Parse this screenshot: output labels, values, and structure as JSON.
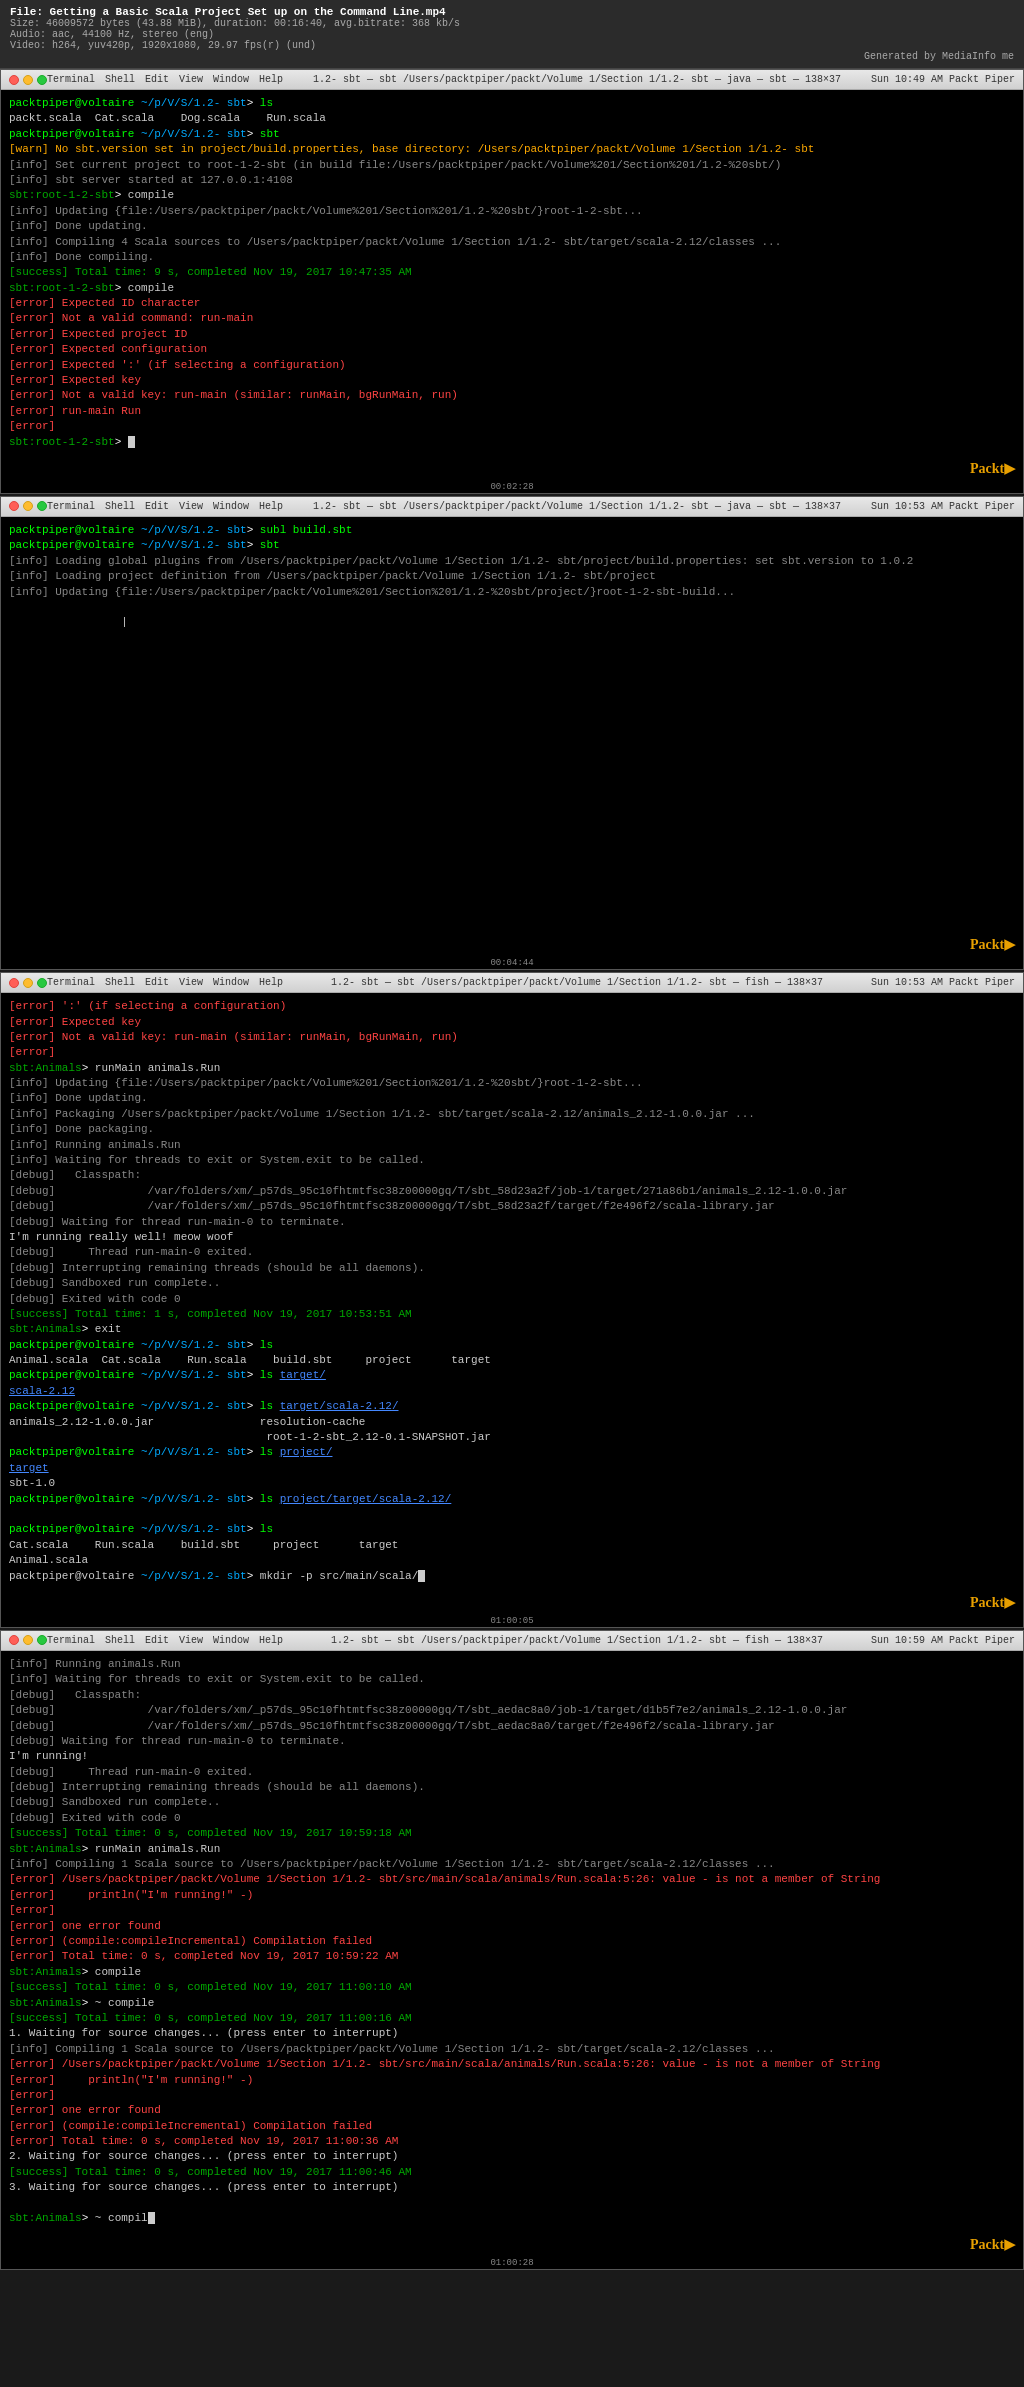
{
  "video": {
    "title": "File: Getting a Basic Scala Project Set up on the Command Line.mp4",
    "size": "Size: 46009572 bytes (43.88 MiB), duration: 00:16:40, avg.bitrate: 368 kb/s",
    "audio": "Audio: aac, 44100 Hz, stereo (eng)",
    "video_stream": "Video: h264, yuv420p, 1920x1080, 29.97 fps(r) (und)",
    "generated": "Generated by MediaInfo me"
  },
  "terminal1": {
    "title": "1.2- sbt — sbt /Users/packtpiper/packt/Volume 1/Section 1/1.2- sbt — java — sbt — 138×37",
    "menu": [
      "Terminal",
      "Shell",
      "Edit",
      "View",
      "Window",
      "Help"
    ],
    "time": "Sun 10:49 AM  Packt Piper",
    "lines": [
      {
        "type": "prompt",
        "text": "packtpiper@voltaire ~/p/V/S/1.2- sbt> ls"
      },
      {
        "type": "output",
        "text": "packt.scala  Cat.scala    Dog.scala    Run.scala"
      },
      {
        "type": "prompt",
        "text": "packtpiper@voltaire ~/p/V/S/1.2- sbt> sbt"
      },
      {
        "type": "warn",
        "text": "[warn] No sbt.version set in project/build.properties, base directory: /Users/packtpiper/packt/Volume 1/Section 1/1.2- sbt"
      },
      {
        "type": "info",
        "text": "[info] Set current project to root-1-2-sbt (in build file:/Users/packtpiper/packt/Volume%201/Section%201/1.2-%20sbt/)"
      },
      {
        "type": "info",
        "text": "[info] sbt server started at 127.0.0.1:4108"
      },
      {
        "type": "prompt",
        "text": "sbt:root-1-2-sbt> compile"
      },
      {
        "type": "info",
        "text": "[info] Updating {file:/Users/packtpiper/packt/Volume%201/Section%201/1.2-%20sbt/}root-1-2-sbt..."
      },
      {
        "type": "info",
        "text": "[info] Done updating."
      },
      {
        "type": "info",
        "text": "[info] Compiling 4 Scala sources to /Users/packtpiper/packt/Volume 1/Section 1/1.2- sbt/target/scala-2.12/classes ..."
      },
      {
        "type": "info",
        "text": "[info] Done compiling."
      },
      {
        "type": "success",
        "text": "[success] Total time: 9 s, completed Nov 19, 2017 10:47:35 AM"
      },
      {
        "type": "prompt",
        "text": "sbt:root-1-2-sbt> compile"
      },
      {
        "type": "error",
        "text": "[error] Expected ID character"
      },
      {
        "type": "error",
        "text": "[error] Not a valid command: run-main"
      },
      {
        "type": "error",
        "text": "[error] Expected project ID"
      },
      {
        "type": "error",
        "text": "[error] Expected configuration"
      },
      {
        "type": "error",
        "text": "[error] Expected ':' (if selecting a configuration)"
      },
      {
        "type": "error",
        "text": "[error] Expected key"
      },
      {
        "type": "error",
        "text": "[error] Not a valid key: run-main (similar: runMain, bgRunMain, run)"
      },
      {
        "type": "error",
        "text": "[error] run-main Run"
      },
      {
        "type": "error",
        "text": "[error]"
      },
      {
        "type": "prompt-cursor",
        "text": "sbt:root-1-2-sbt> "
      }
    ],
    "packt": "Packt▶",
    "timestamp": "00:02:28"
  },
  "terminal2": {
    "title": "1.2- sbt — sbt /Users/packtpiper/packt/Volume 1/Section 1/1.2- sbt — java — sbt — 138×37",
    "menu": [
      "Terminal",
      "Shell",
      "Edit",
      "View",
      "Window",
      "Help"
    ],
    "time": "Sun 10:53 AM  Packt Piper",
    "lines": [
      {
        "type": "prompt",
        "text": "packtpiper@voltaire ~/p/V/S/1.2- sbt> subl build.sbt"
      },
      {
        "type": "prompt",
        "text": "packtpiper@voltaire ~/p/V/S/1.2- sbt> sbt"
      },
      {
        "type": "info",
        "text": "[info] Loading global plugins from /Users/packtpiper/packt/Volume 1/Section 1/1.2- sbt/project/build.properties: set sbt.version to 1.0.2"
      },
      {
        "type": "info",
        "text": "[info] Loading project definition from /Users/packtpiper/packt/Volume 1/Section 1/1.2- sbt/project"
      },
      {
        "type": "info",
        "text": "[info] Updating {file:/Users/packtpiper/packt/Volume%201/Section%201/1.2-%20sbt/project/}root-1-2-sbt-build..."
      },
      {
        "type": "blank",
        "text": ""
      },
      {
        "type": "output",
        "text": "                 |"
      },
      {
        "type": "blank",
        "text": ""
      },
      {
        "type": "blank",
        "text": ""
      },
      {
        "type": "blank",
        "text": ""
      },
      {
        "type": "blank",
        "text": ""
      },
      {
        "type": "blank",
        "text": ""
      },
      {
        "type": "blank",
        "text": ""
      },
      {
        "type": "blank",
        "text": ""
      },
      {
        "type": "blank",
        "text": ""
      },
      {
        "type": "blank",
        "text": ""
      },
      {
        "type": "blank",
        "text": ""
      },
      {
        "type": "blank",
        "text": ""
      },
      {
        "type": "blank",
        "text": ""
      },
      {
        "type": "blank",
        "text": ""
      },
      {
        "type": "blank",
        "text": ""
      },
      {
        "type": "blank",
        "text": ""
      },
      {
        "type": "blank",
        "text": ""
      },
      {
        "type": "blank",
        "text": ""
      },
      {
        "type": "blank",
        "text": ""
      },
      {
        "type": "blank",
        "text": ""
      },
      {
        "type": "blank",
        "text": ""
      },
      {
        "type": "blank",
        "text": ""
      },
      {
        "type": "blank",
        "text": ""
      },
      {
        "type": "blank",
        "text": ""
      },
      {
        "type": "blank",
        "text": ""
      }
    ],
    "packt": "Packt▶",
    "timestamp": "00:04:44"
  },
  "terminal3": {
    "title": "1.2- sbt — sbt /Users/packtpiper/packt/Volume 1/Section 1/1.2- sbt — fish — 138×37",
    "menu": [
      "Terminal",
      "Shell",
      "Edit",
      "View",
      "Window",
      "Help"
    ],
    "time": "Sun 10:53 AM  Packt Piper",
    "lines": [
      {
        "type": "error",
        "text": "[error] ':' (if selecting a configuration)"
      },
      {
        "type": "error",
        "text": "[error] Expected key"
      },
      {
        "type": "error",
        "text": "[error] Not a valid key: run-main (similar: runMain, bgRunMain, run)"
      },
      {
        "type": "error",
        "text": "[error]"
      },
      {
        "type": "prompt",
        "text": "sbt:Animals> runMain animals.Run"
      },
      {
        "type": "info",
        "text": "[info] Updating {file:/Users/packtpiper/packt/Volume%201/Section%201/1.2-%20sbt/}root-1-2-sbt..."
      },
      {
        "type": "info",
        "text": "[info] Done updating."
      },
      {
        "type": "info",
        "text": "[info] Packaging /Users/packtpiper/packt/Volume 1/Section 1/1.2- sbt/target/scala-2.12/animals_2.12-1.0.0.jar ..."
      },
      {
        "type": "info",
        "text": "[info] Done packaging."
      },
      {
        "type": "info",
        "text": "[info] Running animals.Run"
      },
      {
        "type": "info",
        "text": "[info] Waiting for threads to exit or System.exit to be called."
      },
      {
        "type": "debug",
        "text": "[debug]   Classpath:"
      },
      {
        "type": "debug",
        "text": "[debug]              /var/folders/xm/_p57ds_95c10fhtmtfsc38z00000gq/T/sbt_58d23a2f/job-1/target/271a86b1/animals_2.12-1.0.0.jar"
      },
      {
        "type": "debug",
        "text": "[debug]              /var/folders/xm/_p57ds_95c10fhtmtfsc38z00000gq/T/sbt_58d23a2f/target/f2e496f2/scala-library.jar"
      },
      {
        "type": "debug",
        "text": "[debug] Waiting for thread run-main-0 to terminate."
      },
      {
        "type": "output",
        "text": "I'm running really well! meow woof"
      },
      {
        "type": "debug",
        "text": "[debug]     Thread run-main-0 exited."
      },
      {
        "type": "debug",
        "text": "[debug] Interrupting remaining threads (should be all daemons)."
      },
      {
        "type": "debug",
        "text": "[debug] Sandboxed run complete.."
      },
      {
        "type": "debug",
        "text": "[debug] Exited with code 0"
      },
      {
        "type": "success",
        "text": "[success] Total time: 1 s, completed Nov 19, 2017 10:53:51 AM"
      },
      {
        "type": "prompt",
        "text": "sbt:Animals> exit"
      },
      {
        "type": "prompt",
        "text": "packtpiper@voltaire ~/p/V/S/1.2- sbt> ls"
      },
      {
        "type": "output",
        "text": "Animal.scala  Cat.scala    Run.scala    build.sbt     project      target"
      },
      {
        "type": "prompt",
        "text": "packtpiper@voltaire ~/p/V/S/1.2- sbt> ls target/"
      },
      {
        "type": "output-link",
        "text": "scala-2.12"
      },
      {
        "type": "prompt",
        "text": "packtpiper@voltaire ~/p/V/S/1.2- sbt> ls target/scala-2.12/"
      },
      {
        "type": "output",
        "text": "animals_2.12-1.0.0.jar                resolution-cache"
      },
      {
        "type": "output",
        "text": "                                       root-1-2-sbt_2.12-0.1-SNAPSHOT.jar"
      },
      {
        "type": "prompt",
        "text": "packtpiper@voltaire ~/p/V/S/1.2- sbt> ls project/"
      },
      {
        "type": "output-link",
        "text": "target"
      },
      {
        "type": "output",
        "text": "sbt-1.0"
      },
      {
        "type": "prompt",
        "text": "packtpiper@voltaire ~/p/V/S/1.2- sbt> ls project/target/scala-2.12/"
      },
      {
        "type": "blank",
        "text": ""
      },
      {
        "type": "prompt",
        "text": "packtpiper@voltaire ~/p/V/S/1.2- sbt> ls"
      },
      {
        "type": "output",
        "text": "Cat.scala    Run.scala    build.sbt     project      target"
      },
      {
        "type": "output",
        "text": "Animal.scala"
      },
      {
        "type": "prompt-cursor",
        "text": "packtpiper@voltaire ~/p/V/S/1.2- sbt> mkdir -p src/main/scala/"
      }
    ],
    "packt": "Packt▶",
    "timestamp": "01:00:05"
  },
  "terminal4": {
    "title": "1.2- sbt — sbt /Users/packtpiper/packt/Volume 1/Section 1/1.2- sbt — fish — 138×37",
    "menu": [
      "Terminal",
      "Shell",
      "Edit",
      "View",
      "Window",
      "Help"
    ],
    "time": "Sun 10:59 AM  Packt Piper",
    "lines": [
      {
        "type": "info",
        "text": "[info] Running animals.Run"
      },
      {
        "type": "info",
        "text": "[info] Waiting for threads to exit or System.exit to be called."
      },
      {
        "type": "debug",
        "text": "[debug]   Classpath:"
      },
      {
        "type": "debug",
        "text": "[debug]              /var/folders/xm/_p57ds_95c10fhtmtfsc38z00000gq/T/sbt_aedac8a0/job-1/target/d1b5f7e2/animals_2.12-1.0.0.jar"
      },
      {
        "type": "debug",
        "text": "[debug]              /var/folders/xm/_p57ds_95c10fhtmtfsc38z00000gq/T/sbt_aedac8a0/target/f2e496f2/scala-library.jar"
      },
      {
        "type": "debug",
        "text": "[debug] Waiting for thread run-main-0 to terminate."
      },
      {
        "type": "output",
        "text": "I'm running!"
      },
      {
        "type": "debug",
        "text": "[debug]     Thread run-main-0 exited."
      },
      {
        "type": "debug",
        "text": "[debug] Interrupting remaining threads (should be all daemons)."
      },
      {
        "type": "debug",
        "text": "[debug] Sandboxed run complete.."
      },
      {
        "type": "debug",
        "text": "[debug] Exited with code 0"
      },
      {
        "type": "success",
        "text": "[success] Total time: 0 s, completed Nov 19, 2017 10:59:18 AM"
      },
      {
        "type": "prompt",
        "text": "sbt:Animals> runMain animals.Run"
      },
      {
        "type": "info",
        "text": "[info] Compiling 1 Scala source to /Users/packtpiper/packt/Volume 1/Section 1/1.2- sbt/target/scala-2.12/classes ..."
      },
      {
        "type": "error",
        "text": "[error] /Users/packtpiper/packt/Volume 1/Section 1/1.2- sbt/src/main/scala/animals/Run.scala:5:26: value - is not a member of String"
      },
      {
        "type": "error",
        "text": "[error]     println(\"I'm running!\" -)"
      },
      {
        "type": "error",
        "text": "[error]"
      },
      {
        "type": "error",
        "text": "[error] one error found"
      },
      {
        "type": "error",
        "text": "[error] (compile:compileIncremental) Compilation failed"
      },
      {
        "type": "error",
        "text": "[error] Total time: 0 s, completed Nov 19, 2017 10:59:22 AM"
      },
      {
        "type": "prompt",
        "text": "sbt:Animals> compile"
      },
      {
        "type": "success",
        "text": "[success] Total time: 0 s, completed Nov 19, 2017 11:00:10 AM"
      },
      {
        "type": "prompt",
        "text": "sbt:Animals> ~ compile"
      },
      {
        "type": "success",
        "text": "[success] Total time: 0 s, completed Nov 19, 2017 11:00:16 AM"
      },
      {
        "type": "output",
        "text": "1. Waiting for source changes... (press enter to interrupt)"
      },
      {
        "type": "info",
        "text": "[info] Compiling 1 Scala source to /Users/packtpiper/packt/Volume 1/Section 1/1.2- sbt/target/scala-2.12/classes ..."
      },
      {
        "type": "error",
        "text": "[error] /Users/packtpiper/packt/Volume 1/Section 1/1.2- sbt/src/main/scala/animals/Run.scala:5:26: value - is not a member of String"
      },
      {
        "type": "error",
        "text": "[error]     println(\"I'm running!\" -)"
      },
      {
        "type": "error",
        "text": "[error]"
      },
      {
        "type": "error",
        "text": "[error] one error found"
      },
      {
        "type": "error",
        "text": "[error] (compile:compileIncremental) Compilation failed"
      },
      {
        "type": "error",
        "text": "[error] Total time: 0 s, completed Nov 19, 2017 11:00:36 AM"
      },
      {
        "type": "output",
        "text": "2. Waiting for source changes... (press enter to interrupt)"
      },
      {
        "type": "success",
        "text": "[success] Total time: 0 s, completed Nov 19, 2017 11:00:46 AM"
      },
      {
        "type": "output",
        "text": "3. Waiting for source changes... (press enter to interrupt)"
      },
      {
        "type": "blank",
        "text": ""
      },
      {
        "type": "prompt-cursor",
        "text": "sbt:Animals> ~ compil"
      }
    ],
    "packt": "Packt▶",
    "timestamp": "01:00:28"
  }
}
